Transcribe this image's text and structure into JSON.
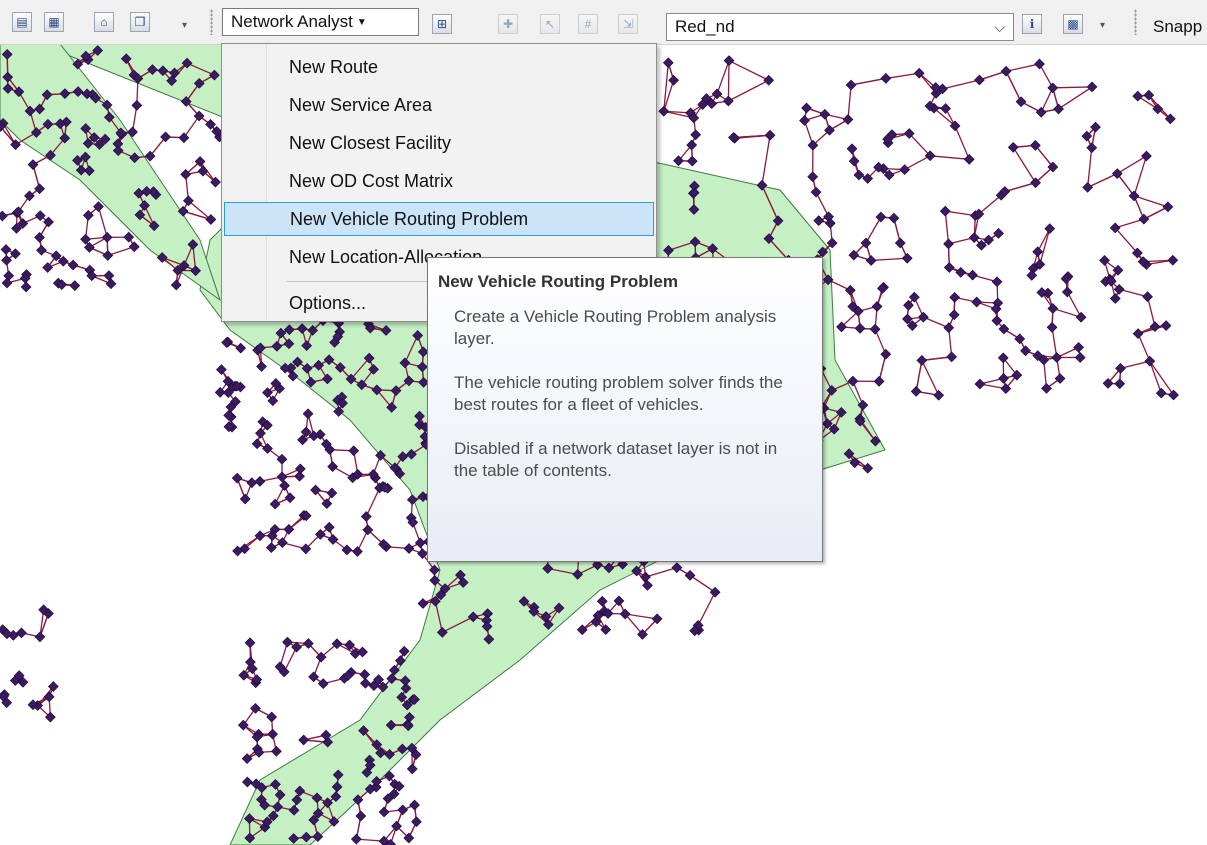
{
  "toolbar": {
    "network_analyst_label": "Network Analyst",
    "dataset_value": "Red_nd",
    "snapping_label": "Snapp"
  },
  "menu": {
    "items": [
      "New Route",
      "New Service Area",
      "New Closest Facility",
      "New OD Cost Matrix",
      "New Vehicle Routing Problem",
      "New Location-Allocation"
    ],
    "options": "Options...",
    "highlighted_index": 4
  },
  "tooltip": {
    "title": "New Vehicle Routing Problem",
    "p1": "Create a Vehicle Routing Problem analysis layer.",
    "p2": "The vehicle routing problem solver finds the best routes for a fleet of vehicles.",
    "p3": "Disabled if a network dataset layer is not in the table of contents."
  },
  "colors": {
    "land": "#c4f0c4",
    "roads": "#8c1a3c",
    "nodes": "#3b1a63",
    "menu_highlight": "#cce4f7"
  }
}
